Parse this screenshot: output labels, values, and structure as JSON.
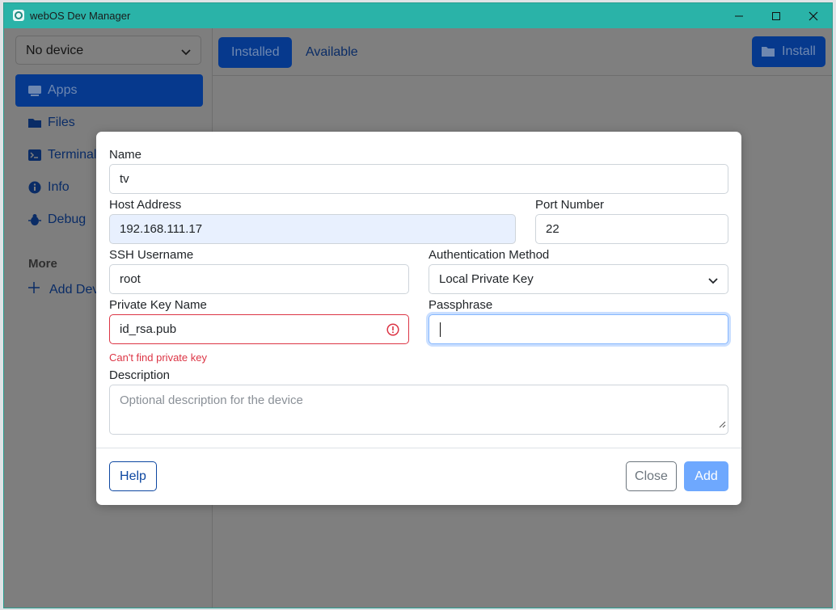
{
  "window": {
    "title": "webOS Dev Manager"
  },
  "sidebar": {
    "device_select": "No device",
    "items": [
      {
        "label": "Apps",
        "icon": "computer-icon"
      },
      {
        "label": "Files",
        "icon": "folder-icon"
      },
      {
        "label": "Terminal",
        "icon": "terminal-icon"
      },
      {
        "label": "Info",
        "icon": "info-icon"
      },
      {
        "label": "Debug",
        "icon": "bug-icon"
      }
    ],
    "section_title": "More",
    "add_device": "Add Device"
  },
  "main": {
    "tabs": [
      {
        "label": "Installed"
      },
      {
        "label": "Available"
      }
    ],
    "install_label": "Install"
  },
  "dialog": {
    "name_label": "Name",
    "name_value": "tv",
    "host_label": "Host Address",
    "host_value": "192.168.111.17",
    "port_label": "Port Number",
    "port_value": "22",
    "ssh_user_label": "SSH Username",
    "ssh_user_value": "root",
    "auth_label": "Authentication Method",
    "auth_value": "Local Private Key",
    "key_label": "Private Key Name",
    "key_value": "id_rsa.pub",
    "key_error": "Can't find private key",
    "pass_label": "Passphrase",
    "pass_value": "",
    "desc_label": "Description",
    "desc_placeholder": "Optional description for the device",
    "help_label": "Help",
    "close_label": "Close",
    "add_label": "Add"
  },
  "colors": {
    "titlebar": "#2ab3a8",
    "primary": "#0d47a1",
    "danger": "#dc3545",
    "add_button": "#6ea8fe"
  }
}
